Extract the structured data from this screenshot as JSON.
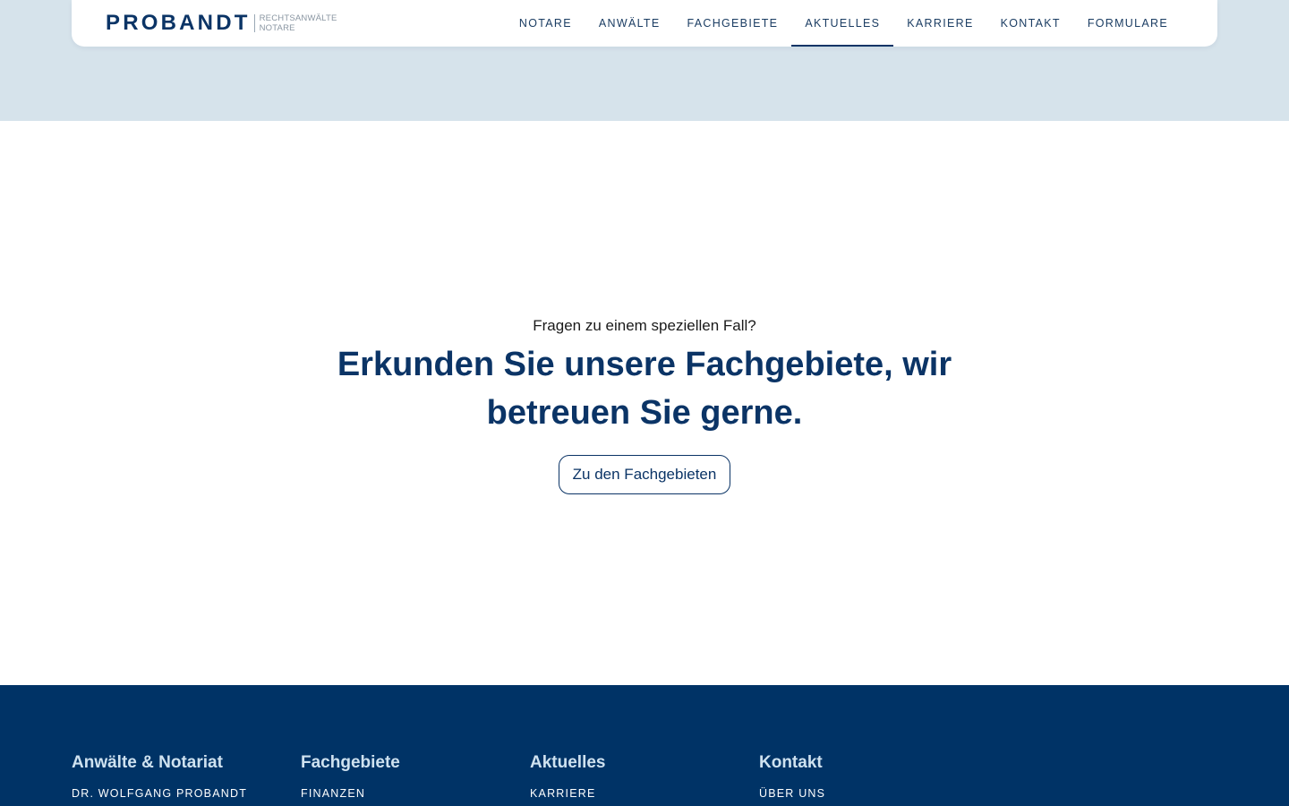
{
  "header": {
    "logo": {
      "name": "PROBANDT",
      "line1": "RECHTSANWÄLTE",
      "line2": "NOTARE"
    },
    "nav": [
      {
        "label": "NOTARE",
        "active": false
      },
      {
        "label": "ANWÄLTE",
        "active": false
      },
      {
        "label": "FACHGEBIETE",
        "active": false
      },
      {
        "label": "AKTUELLES",
        "active": true
      },
      {
        "label": "KARRIERE",
        "active": false
      },
      {
        "label": "KONTAKT",
        "active": false
      },
      {
        "label": "FORMULARE",
        "active": false
      }
    ]
  },
  "cta": {
    "kicker": "Fragen zu einem speziellen Fall?",
    "title": "Erkunden Sie unsere Fachgebiete, wir betreuen Sie gerne.",
    "button": "Zu den Fachgebieten"
  },
  "footer": {
    "columns": [
      {
        "heading": "Anwälte & Notariat",
        "link": "DR. WOLFGANG PROBANDT"
      },
      {
        "heading": "Fachgebiete",
        "link": "FINANZEN"
      },
      {
        "heading": "Aktuelles",
        "link": "KARRIERE"
      },
      {
        "heading": "Kontakt",
        "link": "ÜBER UNS"
      }
    ]
  },
  "colors": {
    "brand": "#0b3466",
    "footer_bg": "#003366",
    "top_band": "#d6e3eb"
  }
}
